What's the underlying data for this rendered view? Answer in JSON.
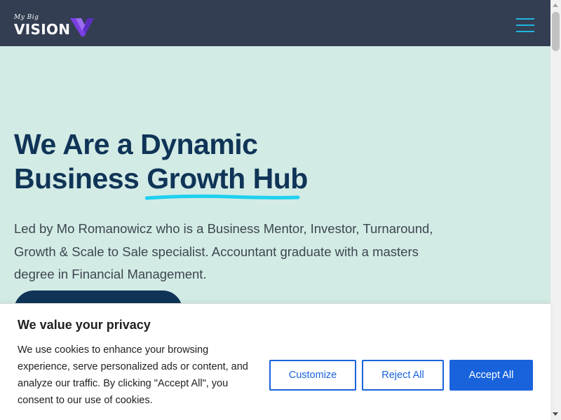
{
  "header": {
    "logo_small": "My Big",
    "logo_main": "VISION",
    "menu_icon": "hamburger-menu-icon",
    "accent_color": "#1fb6e0",
    "bg_color": "#333e52"
  },
  "hero": {
    "title_line1": "We Are a Dynamic",
    "title_line2_prefix": "Business",
    "title_highlight": "Growth Hub",
    "description": "Led by Mo Romanowicz who is a Business Mentor, Investor, Turnaround, Growth & Scale to Sale specialist. Accountant graduate with a masters degree in Financial Management.",
    "bg_color": "#d3ebe5",
    "title_color": "#0f3457",
    "underline_color": "#1fd0f0"
  },
  "cookie": {
    "title": "We value your privacy",
    "text": "We use cookies to enhance your browsing experience, serve personalized ads or content, and analyze our traffic. By clicking \"Accept All\", you consent to our use of cookies.",
    "customize_label": "Customize",
    "reject_label": "Reject All",
    "accept_label": "Accept All",
    "button_color": "#1863dc"
  }
}
